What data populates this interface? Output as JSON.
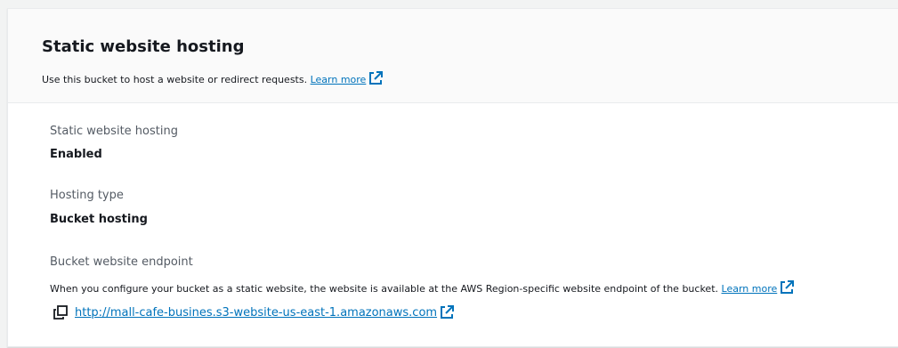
{
  "header": {
    "title": "Static website hosting",
    "description": "Use this bucket to host a website or redirect requests.",
    "learn_more": "Learn more",
    "learn_more_icon": "external-link-icon"
  },
  "fields": {
    "hosting": {
      "label": "Static website hosting",
      "value": "Enabled"
    },
    "hosting_type": {
      "label": "Hosting type",
      "value": "Bucket hosting"
    },
    "endpoint": {
      "label": "Bucket website endpoint",
      "description": "When you configure your bucket as a static website, the website is available at the AWS Region-specific website endpoint of the bucket.",
      "learn_more": "Learn more",
      "url": "http://mall-cafe-busines.s3-website-us-east-1.amazonaws.com",
      "copy_icon": "copy-icon",
      "external_icon": "external-link-icon"
    }
  },
  "colors": {
    "link": "#0073bb",
    "label": "#545b64",
    "text": "#16191f",
    "header_bg": "#fafafa",
    "page_bg": "#f2f3f3"
  }
}
